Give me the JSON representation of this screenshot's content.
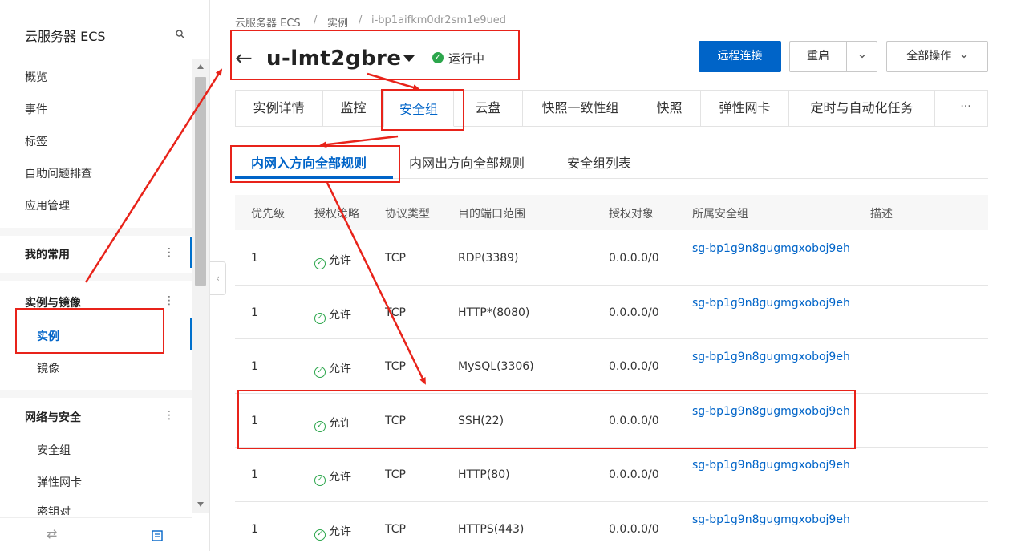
{
  "sidebar": {
    "title": "云服务器 ECS",
    "items": [
      {
        "label": "概览"
      },
      {
        "label": "事件"
      },
      {
        "label": "标签"
      },
      {
        "label": "自助问题排查"
      },
      {
        "label": "应用管理"
      }
    ],
    "groups": [
      {
        "label": "我的常用"
      },
      {
        "label": "实例与镜像",
        "children": [
          "实例",
          "镜像"
        ]
      },
      {
        "label": "网络与安全",
        "children": [
          "安全组",
          "弹性网卡",
          "密钥对"
        ]
      }
    ],
    "footer": {
      "left_icon": "swap-icon",
      "right_icon": "list-icon"
    }
  },
  "breadcrumb": [
    "云服务器 ECS",
    "实例",
    "i-bp1aifkm0dr2sm1e9ued"
  ],
  "header": {
    "title": "u-lmt2gbre",
    "status": "运行中",
    "status_color": "#2ca64c",
    "buttons": {
      "remote": "远程连接",
      "restart": "重启",
      "all_ops": "全部操作"
    }
  },
  "tabs": [
    "实例详情",
    "监控",
    "安全组",
    "云盘",
    "快照一致性组",
    "快照",
    "弹性网卡",
    "定时与自动化任务"
  ],
  "tabs_more": "···",
  "active_tab": "安全组",
  "subtabs": [
    "内网入方向全部规则",
    "内网出方向全部规则",
    "安全组列表"
  ],
  "table": {
    "columns": [
      "优先级",
      "授权策略",
      "协议类型",
      "目的端口范围",
      "授权对象",
      "所属安全组",
      "描述"
    ],
    "rows": [
      {
        "priority": "1",
        "policy": "允许",
        "protocol": "TCP",
        "port": "RDP(3389)",
        "object": "0.0.0.0/0",
        "group": "sg-bp1g9n8gugmgxoboj9eh"
      },
      {
        "priority": "1",
        "policy": "允许",
        "protocol": "TCP",
        "port": "HTTP*(8080)",
        "object": "0.0.0.0/0",
        "group": "sg-bp1g9n8gugmgxoboj9eh"
      },
      {
        "priority": "1",
        "policy": "允许",
        "protocol": "TCP",
        "port": "MySQL(3306)",
        "object": "0.0.0.0/0",
        "group": "sg-bp1g9n8gugmgxoboj9eh"
      },
      {
        "priority": "1",
        "policy": "允许",
        "protocol": "TCP",
        "port": "SSH(22)",
        "object": "0.0.0.0/0",
        "group": "sg-bp1g9n8gugmgxoboj9eh"
      },
      {
        "priority": "1",
        "policy": "允许",
        "protocol": "TCP",
        "port": "HTTP(80)",
        "object": "0.0.0.0/0",
        "group": "sg-bp1g9n8gugmgxoboj9eh"
      },
      {
        "priority": "1",
        "policy": "允许",
        "protocol": "TCP",
        "port": "HTTPS(443)",
        "object": "0.0.0.0/0",
        "group": "sg-bp1g9n8gugmgxoboj9eh"
      }
    ]
  },
  "colors": {
    "accent": "#0064c8",
    "annotation": "#e8231a"
  }
}
